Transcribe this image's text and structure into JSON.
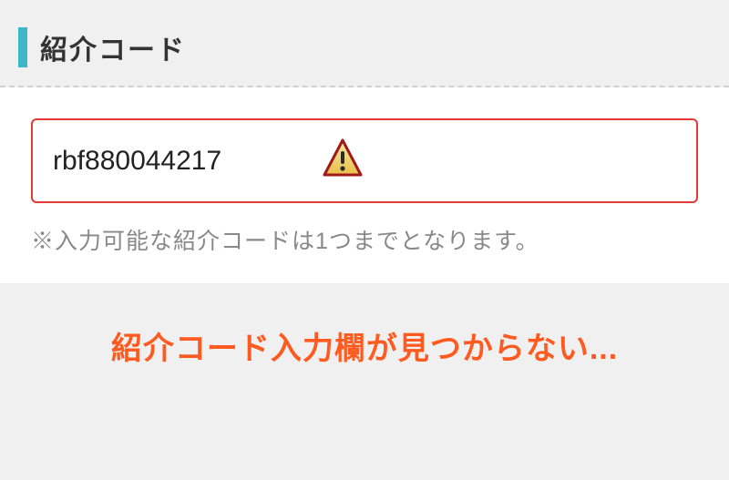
{
  "section": {
    "title": "紹介コード"
  },
  "input": {
    "value": "rbf880044217"
  },
  "help": {
    "text": "※入力可能な紹介コードは1つまでとなります。"
  },
  "footer": {
    "message": "紹介コード入力欄が見つからない..."
  },
  "colors": {
    "accent": "#3cb8c9",
    "error_border": "#e53935",
    "footer_text": "#ff5a1f"
  }
}
